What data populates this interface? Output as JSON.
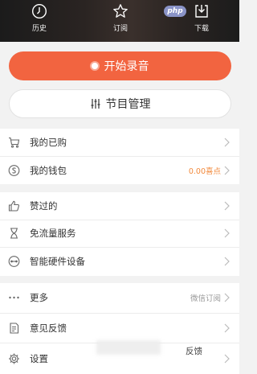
{
  "watermark": "php",
  "top_tabs": [
    {
      "label": "历史",
      "icon": "clock-icon"
    },
    {
      "label": "订阅",
      "icon": "star-icon"
    },
    {
      "label": "下载",
      "icon": "download-icon"
    }
  ],
  "actions": {
    "record_label": "开始录音",
    "program_label": "节目管理"
  },
  "groups": [
    {
      "items": [
        {
          "label": "我的已购",
          "icon": "cart-icon",
          "value": ""
        },
        {
          "label": "我的钱包",
          "icon": "wallet-icon",
          "value": "0.00喜点"
        }
      ]
    },
    {
      "items": [
        {
          "label": "赞过的",
          "icon": "thumbs-up-icon",
          "value": ""
        },
        {
          "label": "免流量服务",
          "icon": "hourglass-icon",
          "value": ""
        },
        {
          "label": "智能硬件设备",
          "icon": "device-icon",
          "value": ""
        }
      ]
    },
    {
      "items": [
        {
          "label": "更多",
          "icon": "more-icon",
          "value": "微信订阅"
        },
        {
          "label": "意见反馈",
          "icon": "feedback-icon",
          "value": ""
        },
        {
          "label": "设置",
          "icon": "gear-icon",
          "value": ""
        }
      ]
    }
  ],
  "overlay": {
    "feedback_text": "反馈"
  },
  "colors": {
    "accent": "#f26440",
    "value_orange": "#f28a3c"
  }
}
